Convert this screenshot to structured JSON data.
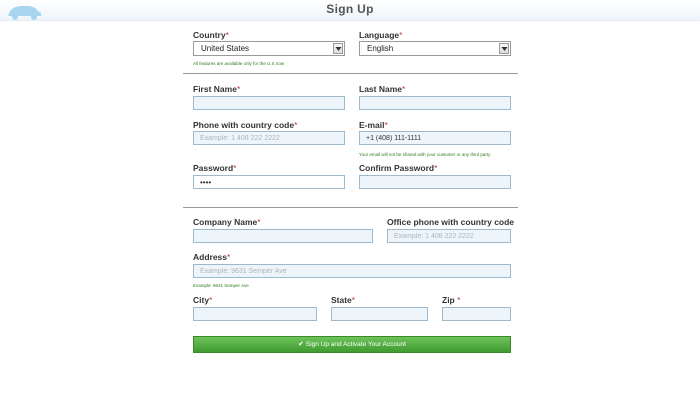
{
  "header": {
    "title": "Sign Up"
  },
  "form": {
    "country": {
      "label": "Country",
      "required": "*",
      "value": "United States",
      "hint": "All features are available only for the U.S now"
    },
    "language": {
      "label": "Language",
      "required": "*",
      "value": "English"
    },
    "first_name": {
      "label": "First Name",
      "required": "*",
      "value": "",
      "placeholder": ""
    },
    "last_name": {
      "label": "Last Name",
      "required": "*",
      "value": "",
      "placeholder": ""
    },
    "phone": {
      "label": "Phone with country code",
      "required": "*",
      "value": "",
      "placeholder": "Example: 1 408 222 2222"
    },
    "email": {
      "label": "E-mail",
      "required": "*",
      "value": "+1 (408) 111-1111",
      "hint": "Your email will not be shared with your customer or any third party"
    },
    "password": {
      "label": "Password",
      "required": "*",
      "value": "••••"
    },
    "confirm_password": {
      "label": "Confirm Password",
      "required": "*",
      "value": ""
    },
    "company": {
      "label": "Company Name",
      "required": "*",
      "value": ""
    },
    "office_phone": {
      "label": "Office phone with country code",
      "placeholder": "Example: 1 408 222 2222"
    },
    "address": {
      "label": "Address",
      "required": "*",
      "placeholder": "Example: 9631 Semper Ave",
      "hint": "Example: 9631 Semper Ave"
    },
    "city": {
      "label": "City",
      "required": "*",
      "value": ""
    },
    "state": {
      "label": "State",
      "required": "*",
      "value": ""
    },
    "zip": {
      "label": "Zip ",
      "required": "*",
      "value": ""
    },
    "submit": {
      "icon": "check-icon",
      "label": "Sign Up and Activate Your Account"
    }
  },
  "colors": {
    "accent_green": "#4caf3a",
    "required": "#c0392b",
    "field_bg": "#edf5fb",
    "hint_green": "#2f7a1f"
  }
}
